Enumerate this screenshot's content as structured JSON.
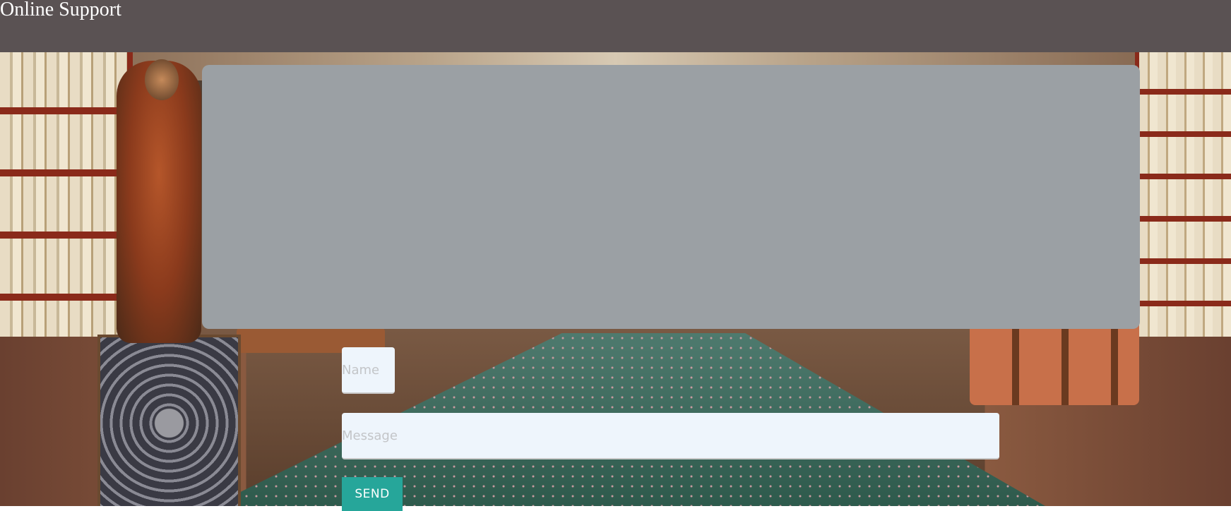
{
  "header": {
    "title": "Online Support",
    "background_color": "#5a5253"
  },
  "chat_panel": {
    "background_color": "#9ba0a4"
  },
  "form": {
    "name_placeholder": "Name",
    "message_placeholder": "Message",
    "send_label": "SEND",
    "send_color": "#26a69a"
  }
}
